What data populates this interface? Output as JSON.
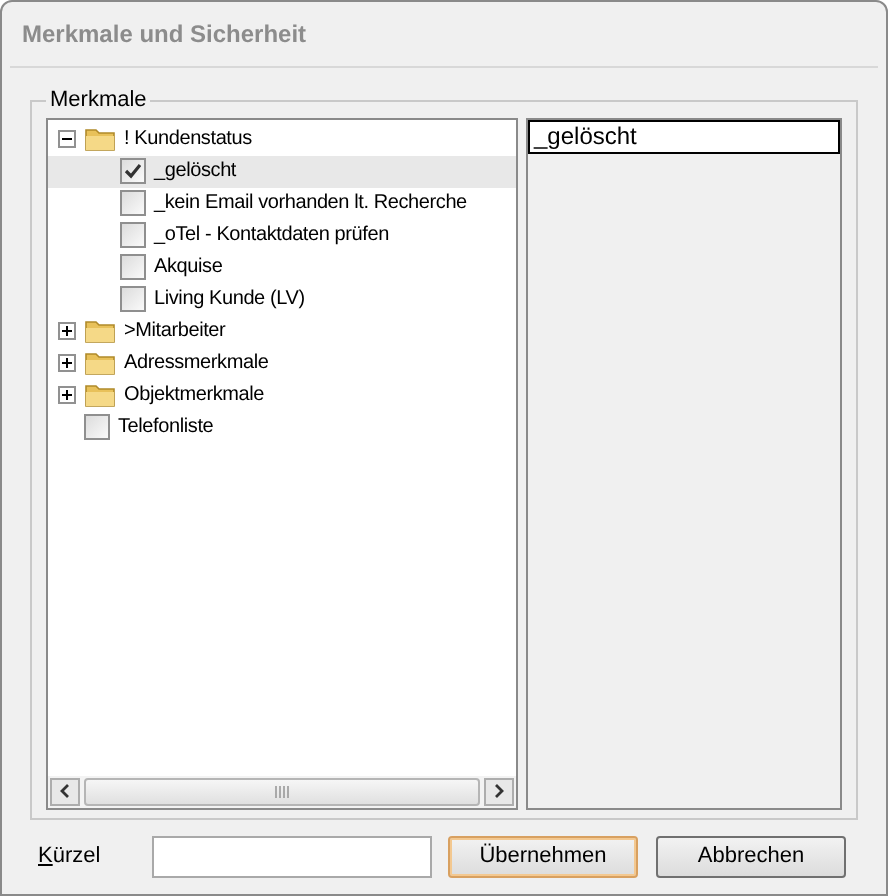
{
  "window": {
    "title": "Merkmale und Sicherheit"
  },
  "group": {
    "label": "Merkmale"
  },
  "tree": [
    {
      "kind": "folder",
      "label": "! Kundenstatus",
      "expanded": true,
      "selected": false,
      "children": [
        {
          "kind": "checkbox",
          "label": "_gelöscht",
          "checked": true,
          "selected": true
        },
        {
          "kind": "checkbox",
          "label": "_kein Email vorhanden lt. Recherche",
          "checked": false,
          "selected": false
        },
        {
          "kind": "checkbox",
          "label": "_oTel - Kontaktdaten prüfen",
          "checked": false,
          "selected": false
        },
        {
          "kind": "checkbox",
          "label": "Akquise",
          "checked": false,
          "selected": false
        },
        {
          "kind": "checkbox",
          "label": "Living Kunde (LV)",
          "checked": false,
          "selected": false
        }
      ]
    },
    {
      "kind": "folder",
      "label": ">Mitarbeiter",
      "expanded": false,
      "selected": false
    },
    {
      "kind": "folder",
      "label": "Adressmerkmale",
      "expanded": false,
      "selected": false
    },
    {
      "kind": "folder",
      "label": "Objektmerkmale",
      "expanded": false,
      "selected": false
    },
    {
      "kind": "checkbox",
      "label": "Telefonliste",
      "checked": false,
      "selected": false
    }
  ],
  "detail": {
    "value": "_gelöscht"
  },
  "shortcut": {
    "label": "Kürzel"
  },
  "buttons": [
    {
      "label": "Übernehmen",
      "focused": true
    },
    {
      "label": "Abbrechen",
      "focused": false
    }
  ]
}
